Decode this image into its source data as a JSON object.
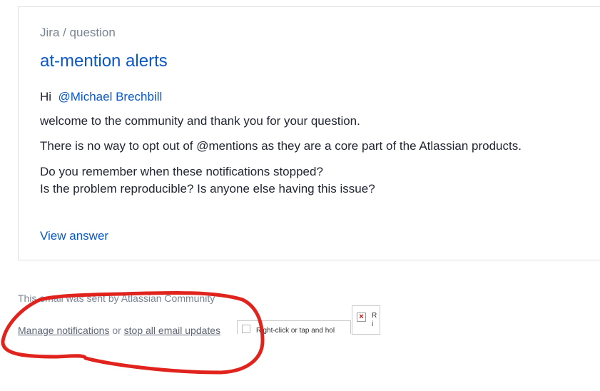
{
  "email": {
    "breadcrumb": "Jira / question",
    "title": "at-mention alerts",
    "greeting": "Hi",
    "mention": "@Michael Brechbill",
    "paragraphs": [
      "welcome to the community and thank you for your question.",
      "There is no way to opt out of @mentions as they are a core part of the Atlassian products.",
      "Do you remember when these notifications stopped?",
      "Is the problem reproducible? Is anyone else having this issue?"
    ],
    "view_answer_link": "View answer"
  },
  "footer": {
    "sent_by": "This email was sent by Atlassian Community",
    "manage_link": "Manage notifications",
    "separator": "or",
    "stop_link": "stop all email updates",
    "broken_image_1_text": "Right-click or tap and hol",
    "broken_image_2_text_line1": "R",
    "broken_image_2_text_line2": "i"
  },
  "annotation": {
    "color": "#e0231c"
  }
}
